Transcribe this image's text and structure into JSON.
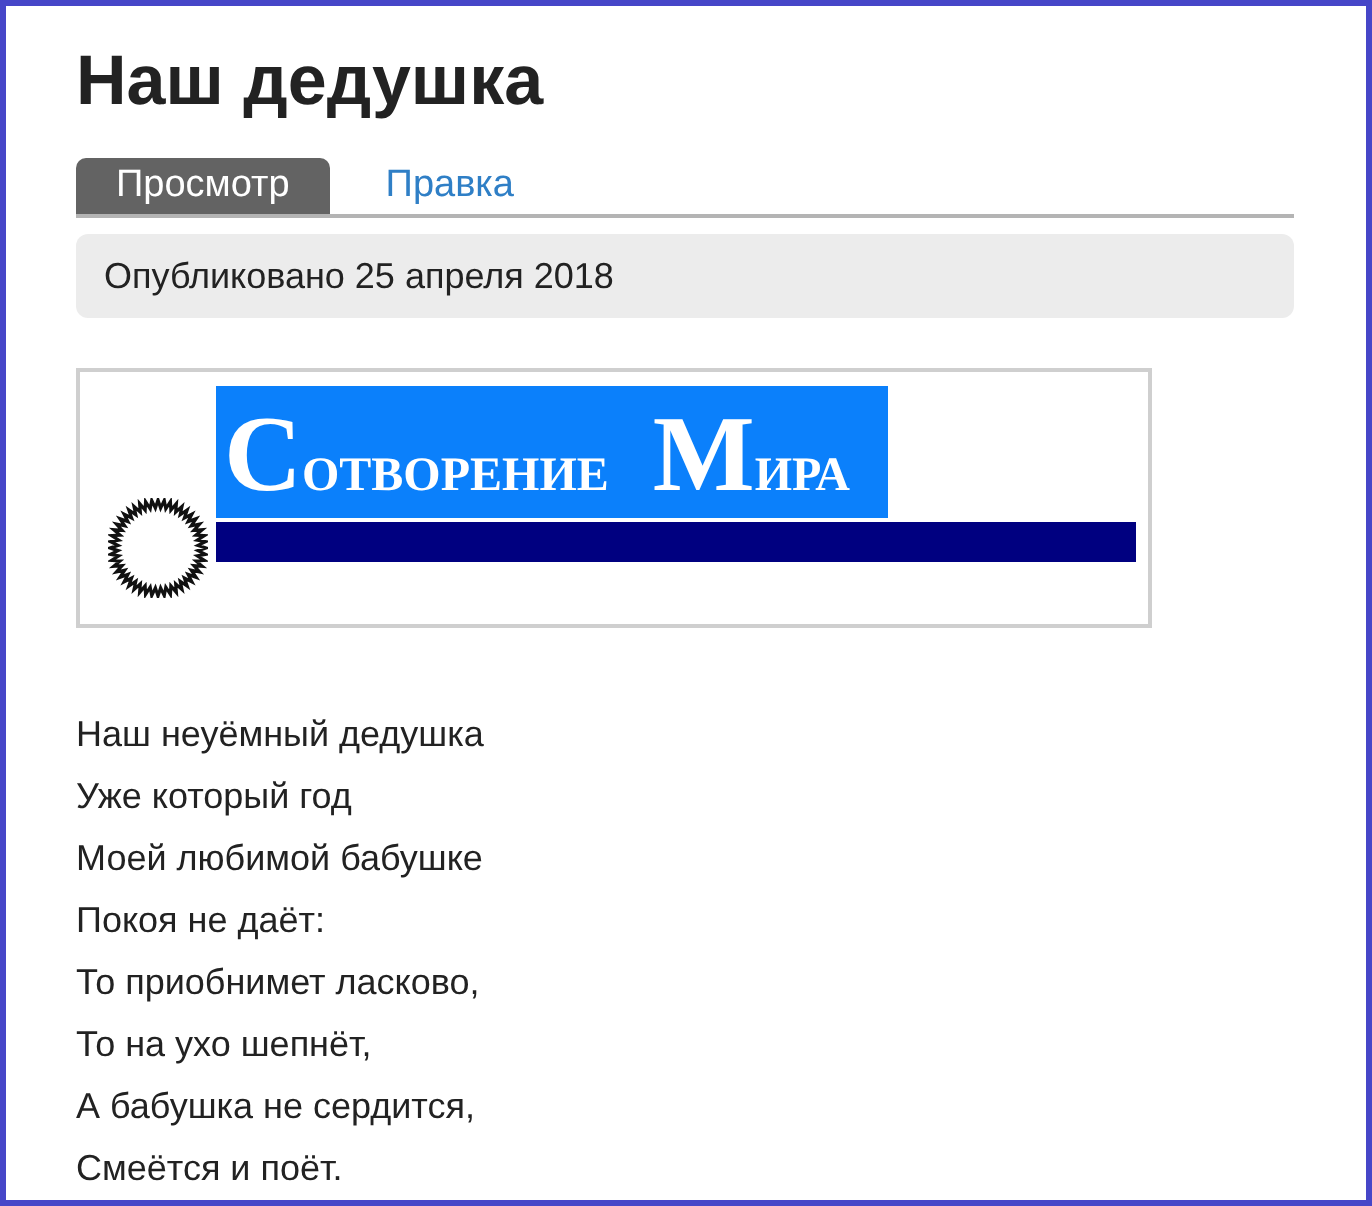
{
  "page": {
    "title": "Наш дедушка"
  },
  "tabs": [
    {
      "label": "Просмотр",
      "selected": true
    },
    {
      "label": "Правка",
      "selected": false
    }
  ],
  "meta": {
    "published": "Опубликовано 25 апреля 2018"
  },
  "logo": {
    "text": "СОТВОРЕНИЕ МИРА"
  },
  "poem": [
    "Наш неуёмный дедушка",
    "Уже который год",
    "Моей любимой бабушке",
    "Покоя не даёт:",
    "То приобнимет ласково,",
    "То на ухо шепнёт,",
    "А бабушка не сердится,",
    "Смеётся и поёт."
  ]
}
